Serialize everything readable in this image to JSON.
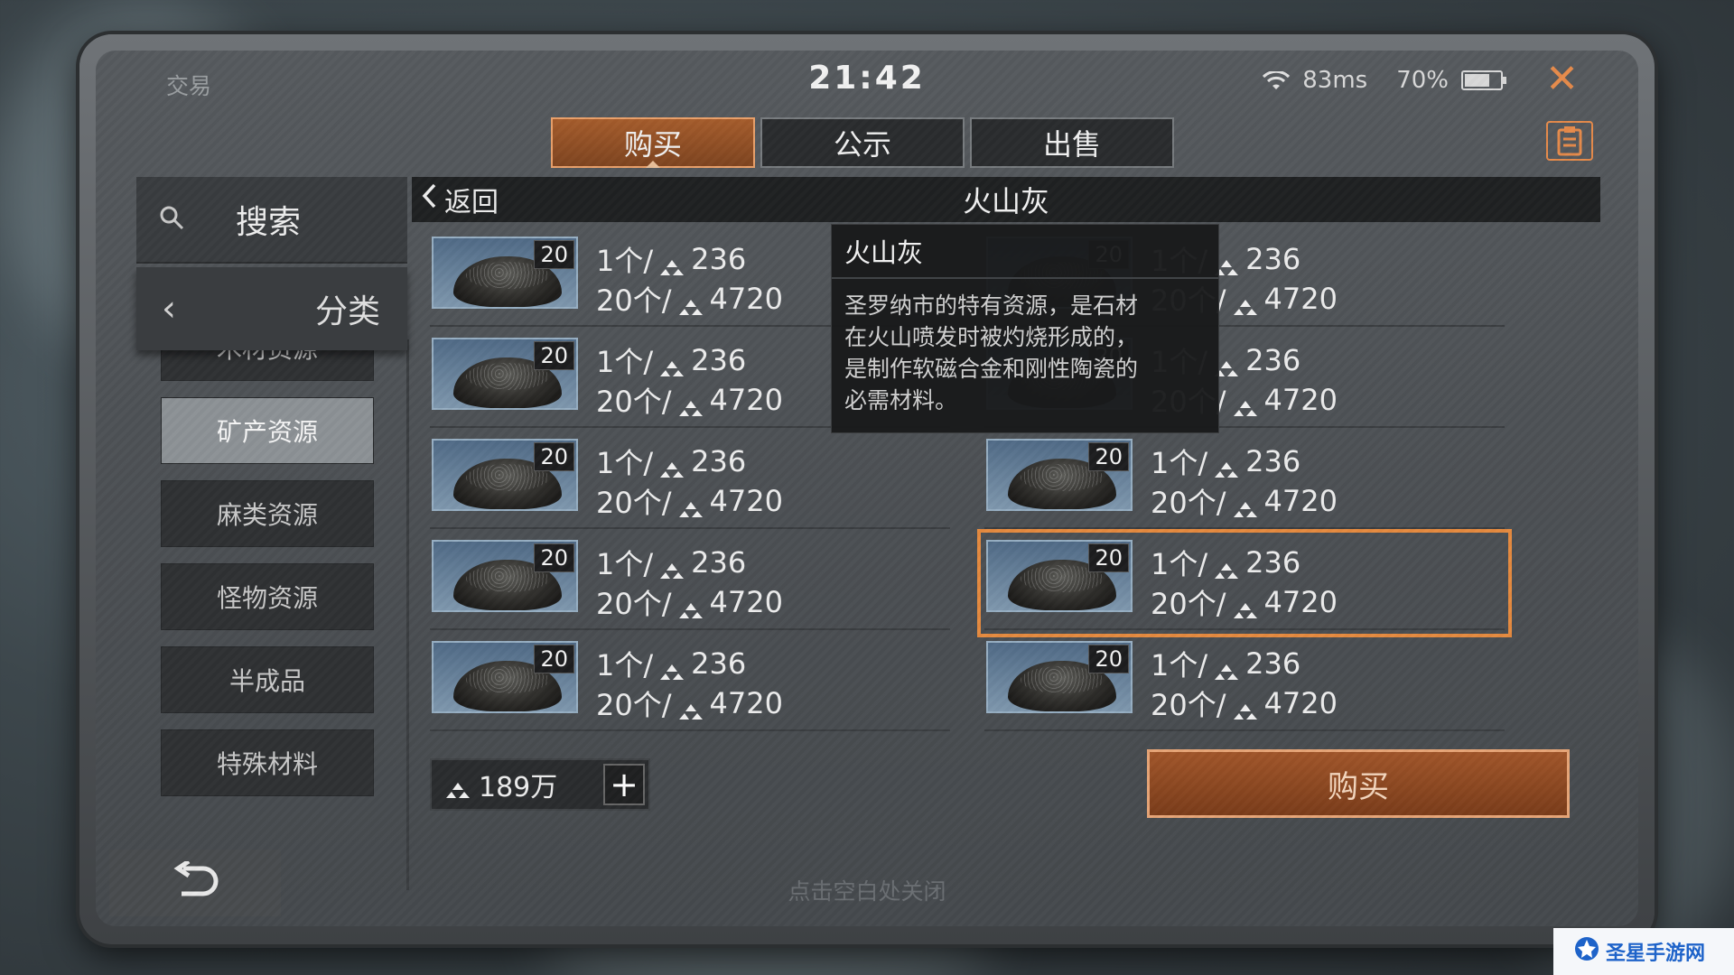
{
  "status_bar": {
    "app_title": "交易",
    "clock": "21:42",
    "ping": "83ms",
    "battery": "70%",
    "battery_level": 0.7
  },
  "tabs": [
    {
      "label": "购买",
      "active": true
    },
    {
      "label": "公示",
      "active": false
    },
    {
      "label": "出售",
      "active": false
    }
  ],
  "sidebar": {
    "search_label": "搜索",
    "category_label": "分类",
    "categories": [
      {
        "label": "木材资源",
        "active": false
      },
      {
        "label": "矿产资源",
        "active": true
      },
      {
        "label": "麻类资源",
        "active": false
      },
      {
        "label": "怪物资源",
        "active": false
      },
      {
        "label": "半成品",
        "active": false
      },
      {
        "label": "特殊材料",
        "active": false
      }
    ]
  },
  "content": {
    "back_label": "返回",
    "title": "火山灰",
    "listings": [
      {
        "qty": "20",
        "unit_line": "1个/",
        "unit_price": "236",
        "bulk_line": "20个/",
        "bulk_price": "4720"
      },
      {
        "qty": "20",
        "unit_line": "1个/",
        "unit_price": "236",
        "bulk_line": "20个/",
        "bulk_price": "4720"
      },
      {
        "qty": "20",
        "unit_line": "1个/",
        "unit_price": "236",
        "bulk_line": "20个/",
        "bulk_price": "4720"
      },
      {
        "qty": "20",
        "unit_line": "1个/",
        "unit_price": "236",
        "bulk_line": "20个/",
        "bulk_price": "4720"
      },
      {
        "qty": "20",
        "unit_line": "1个/",
        "unit_price": "236",
        "bulk_line": "20个/",
        "bulk_price": "4720"
      },
      {
        "qty": "20",
        "unit_line": "1个/",
        "unit_price": "236",
        "bulk_line": "20个/",
        "bulk_price": "4720"
      },
      {
        "qty": "20",
        "unit_line": "1个/",
        "unit_price": "236",
        "bulk_line": "20个/",
        "bulk_price": "4720"
      },
      {
        "qty": "20",
        "unit_line": "1个/",
        "unit_price": "236",
        "bulk_line": "20个/",
        "bulk_price": "4720"
      },
      {
        "qty": "20",
        "unit_line": "1个/",
        "unit_price": "236",
        "bulk_line": "20个/",
        "bulk_price": "4720"
      },
      {
        "qty": "20",
        "unit_line": "1个/",
        "unit_price": "236",
        "bulk_line": "20个/",
        "bulk_price": "4720"
      }
    ]
  },
  "tooltip": {
    "title": "火山灰",
    "lines": [
      "圣罗纳市的特有资源，是石材",
      "在火山喷发时被灼烧形成的，",
      "是制作软磁合金和刚性陶瓷的",
      "必需材料。"
    ]
  },
  "footer": {
    "balance": "189万",
    "buy_label": "购买",
    "close_hint": "点击空白处关闭"
  },
  "watermark": {
    "text": "圣星手游网"
  },
  "colors": {
    "accent": "#e58a3f",
    "active_tab": "#a55c2c",
    "buy_button": "#8f4a24"
  },
  "icons": [
    "search-icon",
    "chevron-left-icon",
    "wifi-icon",
    "battery-icon",
    "close-icon",
    "clipboard-icon",
    "currency-icon",
    "plus-icon",
    "undo-arrow-icon"
  ]
}
